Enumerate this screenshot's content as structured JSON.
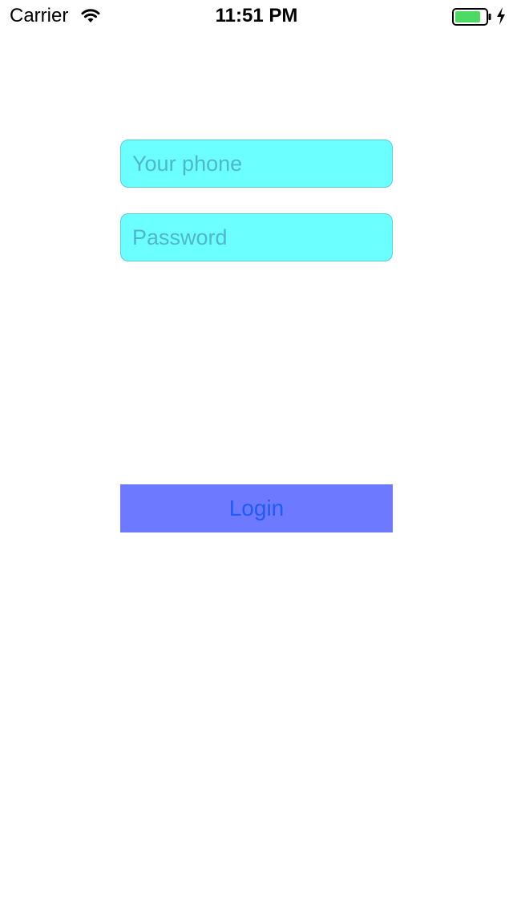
{
  "status_bar": {
    "carrier": "Carrier",
    "time": "11:51 PM",
    "wifi_icon": "wifi-icon",
    "battery_icon": "battery-icon",
    "charging_icon": "charging-bolt-icon",
    "battery_color": "#4cd964"
  },
  "form": {
    "phone": {
      "value": "",
      "placeholder": "Your phone"
    },
    "password": {
      "value": "",
      "placeholder": "Password"
    },
    "login_label": "Login"
  },
  "colors": {
    "field_background": "#6cffff",
    "placeholder": "#4fb6cf",
    "button_background": "#6d79ff",
    "button_text": "#1f5cf5"
  }
}
